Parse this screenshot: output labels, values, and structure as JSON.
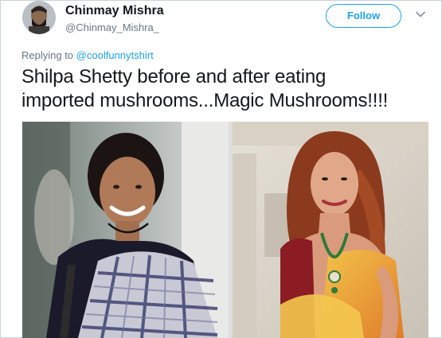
{
  "user": {
    "display_name": "Chinmay Mishra",
    "handle": "@Chinmay_Mishra_"
  },
  "follow_label": "Follow",
  "reply": {
    "prefix": "Replying to",
    "mention": "@coolfunnytshirt"
  },
  "tweet": {
    "line1": "Shilpa Shetty before and after eating",
    "line2": "imported mushrooms...Magic Mushrooms!!!!"
  },
  "colors": {
    "accent": "#1da1f2",
    "secondary_text": "#657786",
    "primary_text": "#14171a"
  },
  "icons": {
    "menu": "chevron-down-icon"
  }
}
